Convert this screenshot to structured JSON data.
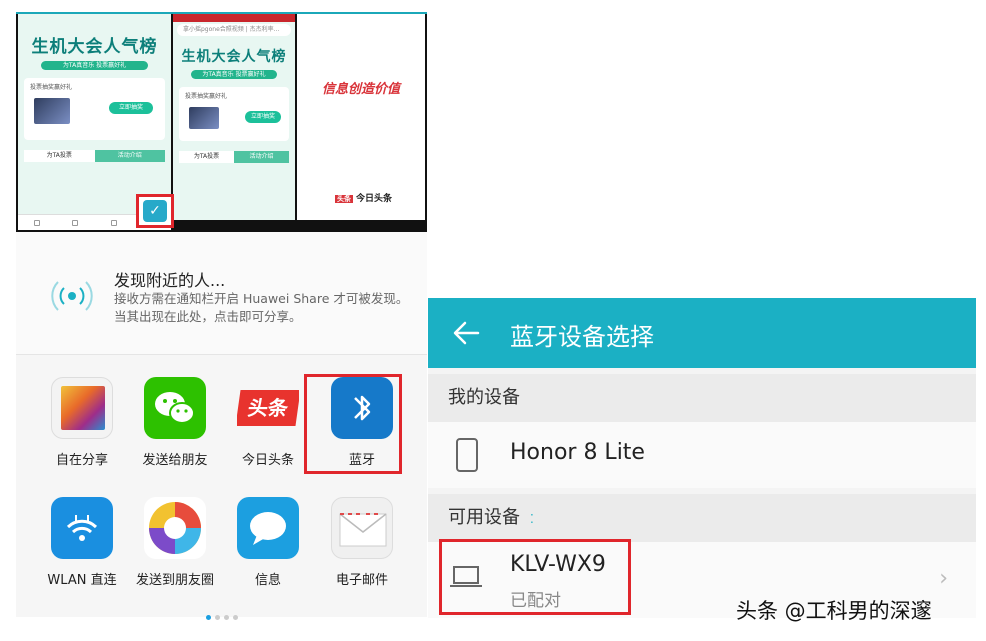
{
  "strip": {
    "phone1": {
      "title": "生机大会人气榜",
      "subtitle": "为TA真音乐 投票赢好礼",
      "card_label": "投票抽奖赢好礼",
      "card_button": "立即抽奖",
      "tab_a": "为TA投票",
      "tab_b": "活动介绍"
    },
    "phone2": {
      "search": "拿小摇pgone合照视频 | 杰杰利率...",
      "title": "生机大会人气榜",
      "subtitle": "为TA真音乐 投票赢好礼",
      "card_label": "投票抽奖赢好礼",
      "card_button": "立即抽奖",
      "tab_a": "为TA投票",
      "tab_b": "活动介绍"
    },
    "phone3": {
      "slogan": "信息创造价值",
      "brand_tag": "头条",
      "brand": "今日头条"
    },
    "check_icon": "check-icon"
  },
  "share": {
    "title": "发现附近的人...",
    "description": "接收方需在通知栏开启 Huawei Share 才可被发现。当其出现在此处，点击即可分享。",
    "icon": "wireless-share-icon"
  },
  "apps": [
    {
      "label": "自在分享",
      "icon": "gallery-icon"
    },
    {
      "label": "发送给朋友",
      "icon": "wechat-icon"
    },
    {
      "label": "今日头条",
      "icon": "toutiao-icon",
      "logo_text": "头条"
    },
    {
      "label": "蓝牙",
      "icon": "bluetooth-icon"
    },
    {
      "label": "WLAN 直连",
      "icon": "wlan-direct-icon"
    },
    {
      "label": "发送到朋友圈",
      "icon": "moments-icon"
    },
    {
      "label": "信息",
      "icon": "message-icon"
    },
    {
      "label": "电子邮件",
      "icon": "mail-icon"
    }
  ],
  "pager": {
    "pages": 4,
    "current": 1
  },
  "bluetooth": {
    "title": "蓝牙设备选择",
    "my_devices_header": "我的设备",
    "my_devices": [
      {
        "name": "Honor 8 Lite",
        "icon": "phone-icon"
      }
    ],
    "available_header": "可用设备",
    "available": [
      {
        "name": "KLV-WX9",
        "status": "已配对",
        "icon": "laptop-icon"
      }
    ]
  },
  "watermark": "头条 @工科男的深邃",
  "colors": {
    "accent": "#1bb0c4",
    "highlight": "#e0262c"
  }
}
